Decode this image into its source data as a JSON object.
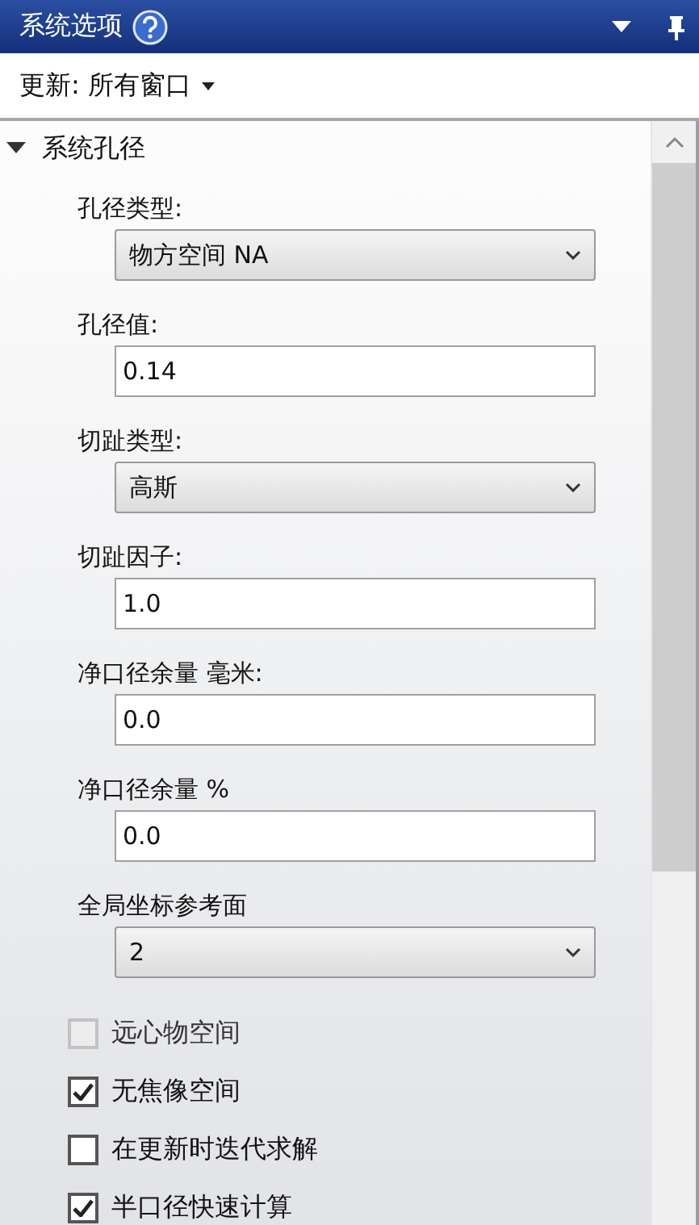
{
  "window": {
    "title": "系统选项"
  },
  "update": {
    "label": "更新: 所有窗口"
  },
  "section": {
    "title": "系统孔径",
    "expanded": true,
    "fields": [
      {
        "label": "孔径类型:",
        "kind": "dropdown",
        "value": "物方空间 NA"
      },
      {
        "label": "孔径值:",
        "kind": "text",
        "value": "0.14"
      },
      {
        "label": "切趾类型:",
        "kind": "dropdown",
        "value": "高斯"
      },
      {
        "label": "切趾因子:",
        "kind": "text",
        "value": "1.0"
      },
      {
        "label": "净口径余量 毫米:",
        "kind": "text",
        "value": "0.0"
      },
      {
        "label": "净口径余量 %",
        "kind": "text",
        "value": "0.0"
      },
      {
        "label": "全局坐标参考面",
        "kind": "dropdown",
        "value": "2"
      }
    ],
    "checks": [
      {
        "label": "远心物空间",
        "checked": false,
        "disabled": true
      },
      {
        "label": "无焦像空间",
        "checked": true,
        "disabled": false
      },
      {
        "label": "在更新时迭代求解",
        "checked": false,
        "disabled": false
      },
      {
        "label": "半口径快速计算",
        "checked": true,
        "disabled": false
      }
    ]
  }
}
